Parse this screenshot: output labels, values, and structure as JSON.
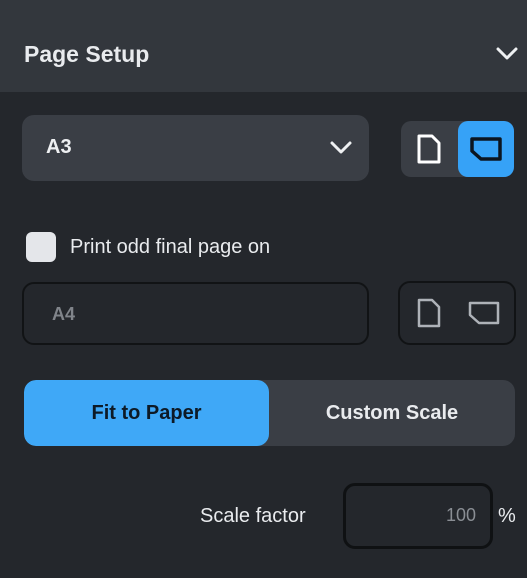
{
  "header": {
    "title": "Page Setup",
    "collapse_icon": "chevron-down-icon"
  },
  "paper": {
    "selected": "A3",
    "orientation_selected": "landscape",
    "icons": [
      "portrait-page-icon",
      "landscape-page-icon"
    ]
  },
  "odd_page": {
    "checkbox_checked": false,
    "label": "Print odd final page on",
    "paper_value": "A4"
  },
  "scaling": {
    "options": [
      "Fit to Paper",
      "Custom Scale"
    ],
    "selected": "Fit to Paper"
  },
  "scale_factor": {
    "label": "Scale factor",
    "value": "100",
    "unit": "%"
  },
  "colors": {
    "accent": "#36a2f7",
    "panel_bg": "#24272c",
    "header_bg": "#33373d",
    "control_bg": "#3a3e45"
  }
}
